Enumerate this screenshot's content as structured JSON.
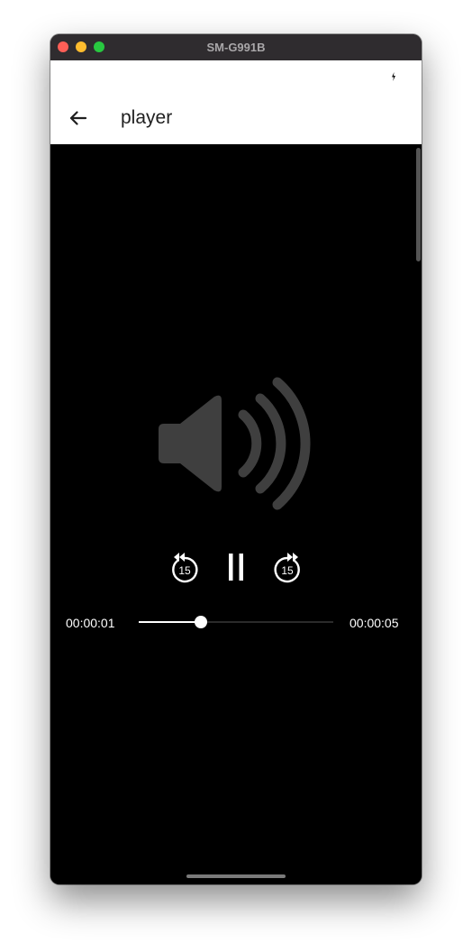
{
  "window": {
    "title": "SM-G991B"
  },
  "appbar": {
    "title": "player",
    "back_icon": "arrow-back-icon"
  },
  "player": {
    "artwork_icon": "volume-up-icon",
    "rewind_icon": "replay-15-icon",
    "rewind_label": "15",
    "pause_icon": "pause-icon",
    "forward_icon": "forward-15-icon",
    "forward_label": "15",
    "current_time": "00:00:01",
    "total_time": "00:00:05",
    "progress": 0.32
  },
  "colors": {
    "background": "#000000",
    "appbar": "#ffffff",
    "artwork": "#3f3f3f",
    "controls": "#ffffff"
  }
}
